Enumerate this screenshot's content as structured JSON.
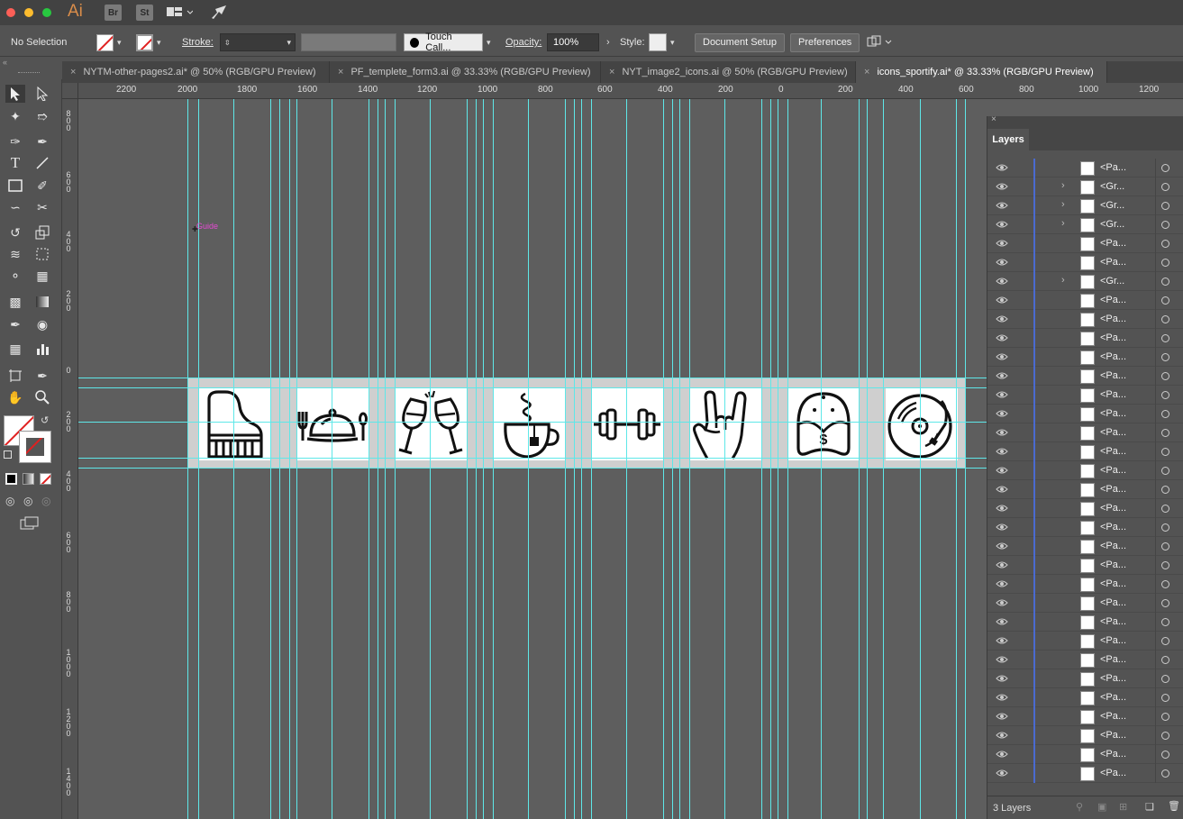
{
  "app": {
    "logo": "Ai",
    "badges": [
      "Br",
      "St"
    ]
  },
  "control_bar": {
    "selection": "No Selection",
    "stroke_label": "Stroke:",
    "brush_label": "Touch Call...",
    "opacity_label": "Opacity:",
    "opacity_value": "100%",
    "style_label": "Style:",
    "document_setup": "Document Setup",
    "preferences": "Preferences"
  },
  "tabs": [
    {
      "label": "NYTM-other-pages2.ai* @ 50% (RGB/GPU Preview)",
      "active": false
    },
    {
      "label": "PF_templete_form3.ai @ 33.33% (RGB/GPU Preview)",
      "active": false
    },
    {
      "label": "NYT_image2_icons.ai @ 50% (RGB/GPU Preview)",
      "active": false
    },
    {
      "label": "icons_sportify.ai* @ 33.33% (RGB/GPU Preview)",
      "active": true
    }
  ],
  "ruler_top": [
    "2200",
    "2000",
    "1800",
    "1600",
    "1400",
    "1200",
    "1000",
    "800",
    "600",
    "400",
    "200",
    "0",
    "200",
    "400",
    "600",
    "800",
    "1000",
    "1200"
  ],
  "ruler_left": [
    "800",
    "600",
    "400",
    "200",
    "0",
    "200",
    "400",
    "600",
    "800",
    "1000",
    "1200",
    "1400"
  ],
  "canvas": {
    "guide_label": "Guide",
    "icons": [
      {
        "name": "piano-icon"
      },
      {
        "name": "dining-platter-icon"
      },
      {
        "name": "champagne-toast-icon"
      },
      {
        "name": "tea-cup-icon"
      },
      {
        "name": "dumbbell-icon"
      },
      {
        "name": "rock-hand-icon"
      },
      {
        "name": "cap-dollar-icon"
      },
      {
        "name": "turntable-icon"
      }
    ]
  },
  "layers_panel": {
    "title": "Layers",
    "footer": "3 Layers",
    "rows": [
      {
        "name": "<Pa...",
        "expand": false
      },
      {
        "name": "<Gr...",
        "expand": true
      },
      {
        "name": "<Gr...",
        "expand": true
      },
      {
        "name": "<Gr...",
        "expand": true
      },
      {
        "name": "<Pa...",
        "expand": false
      },
      {
        "name": "<Pa...",
        "expand": false
      },
      {
        "name": "<Gr...",
        "expand": true
      },
      {
        "name": "<Pa...",
        "expand": false
      },
      {
        "name": "<Pa...",
        "expand": false
      },
      {
        "name": "<Pa...",
        "expand": false
      },
      {
        "name": "<Pa...",
        "expand": false
      },
      {
        "name": "<Pa...",
        "expand": false
      },
      {
        "name": "<Pa...",
        "expand": false
      },
      {
        "name": "<Pa...",
        "expand": false
      },
      {
        "name": "<Pa...",
        "expand": false
      },
      {
        "name": "<Pa...",
        "expand": false
      },
      {
        "name": "<Pa...",
        "expand": false
      },
      {
        "name": "<Pa...",
        "expand": false
      },
      {
        "name": "<Pa...",
        "expand": false
      },
      {
        "name": "<Pa...",
        "expand": false
      },
      {
        "name": "<Pa...",
        "expand": false
      },
      {
        "name": "<Pa...",
        "expand": false
      },
      {
        "name": "<Pa...",
        "expand": false
      },
      {
        "name": "<Pa...",
        "expand": false
      },
      {
        "name": "<Pa...",
        "expand": false
      },
      {
        "name": "<Pa...",
        "expand": false
      },
      {
        "name": "<Pa...",
        "expand": false
      },
      {
        "name": "<Pa...",
        "expand": false
      },
      {
        "name": "<Pa...",
        "expand": false
      },
      {
        "name": "<Pa...",
        "expand": false
      },
      {
        "name": "<Pa...",
        "expand": false
      },
      {
        "name": "<Pa...",
        "expand": false
      },
      {
        "name": "<Pa...",
        "expand": false
      }
    ]
  }
}
